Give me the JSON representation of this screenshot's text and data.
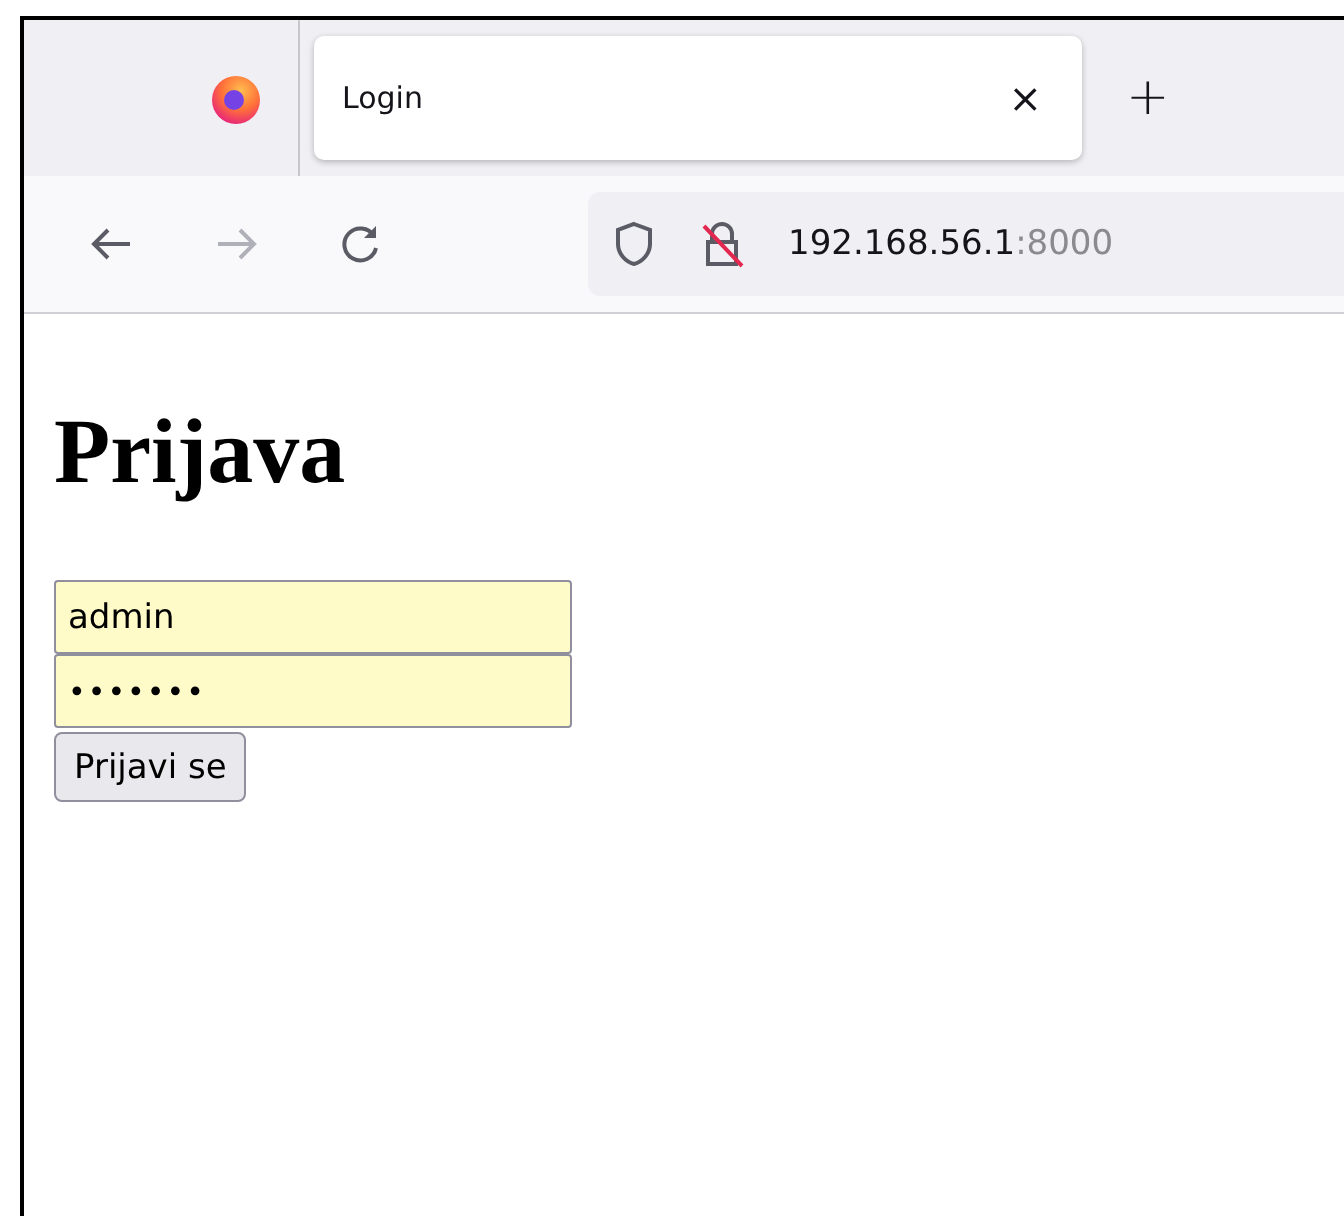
{
  "browser": {
    "tab": {
      "title": "Login",
      "close": "×",
      "selected": true
    },
    "new_tab": "+",
    "nav": {
      "back_disabled": false,
      "forward_disabled": true
    },
    "address": {
      "host": "192.168.56.1",
      "port": ":8000"
    }
  },
  "page": {
    "heading": "Prijava",
    "username": {
      "value": "admin"
    },
    "password": {
      "value": "•••••••"
    },
    "submit": "Prijavi se"
  }
}
